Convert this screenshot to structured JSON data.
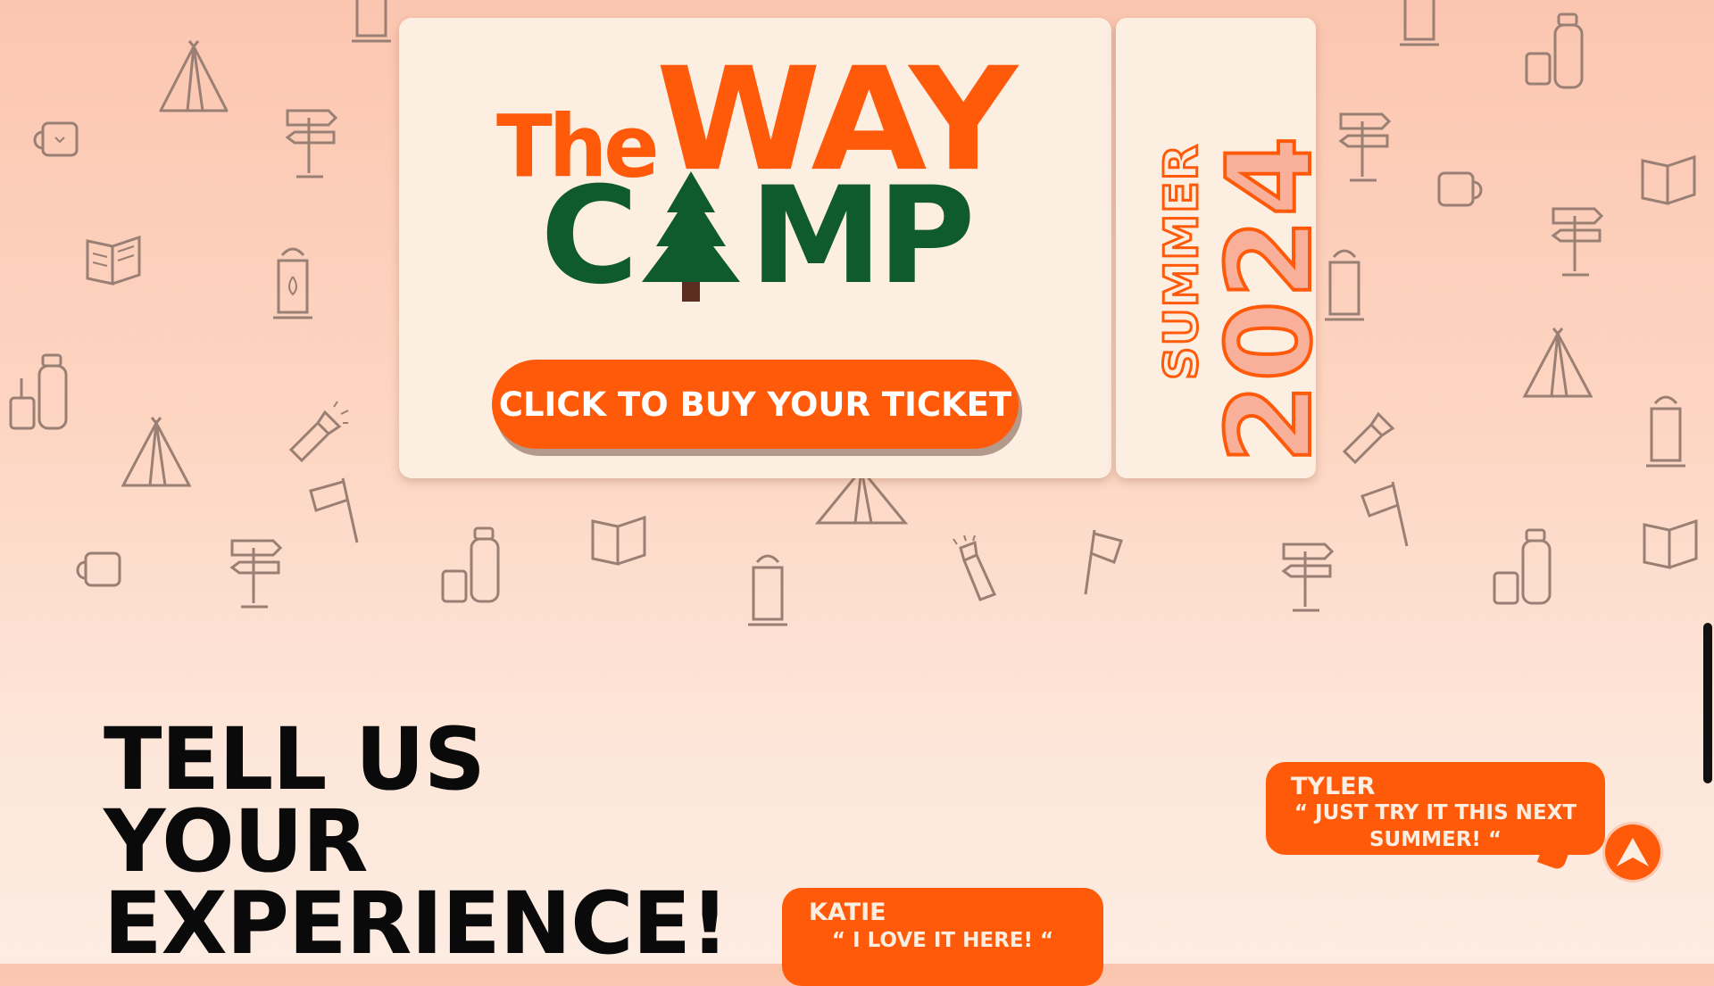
{
  "logo": {
    "the": "The",
    "way": "WAY",
    "camp_left": "C",
    "camp_right": "MP"
  },
  "ticket": {
    "cta_label": "CLICK TO BUY YOUR TICKET",
    "season": "SUMMER",
    "year": "2024"
  },
  "experience": {
    "heading_lines": [
      "TELL US",
      "YOUR",
      "EXPERIENCE!"
    ]
  },
  "testimonials": [
    {
      "name": "TYLER",
      "quote": "“ JUST TRY IT THIS NEXT SUMMER! “"
    },
    {
      "name": "KATIE",
      "quote": "“ I LOVE IT HERE! “"
    }
  ],
  "icons": {
    "scroll_top": "arrow-up-icon",
    "doodles": [
      "tent-icon",
      "mug-icon",
      "signpost-icon",
      "book-icon",
      "lantern-icon",
      "thermos-icon",
      "flashlight-icon",
      "flag-icon"
    ]
  },
  "colors": {
    "brand_orange": "#ff5a0a",
    "forest_green": "#0f5a2e",
    "ticket_cream": "#fdeee2",
    "stub_year_fill": "#f9b09a"
  }
}
